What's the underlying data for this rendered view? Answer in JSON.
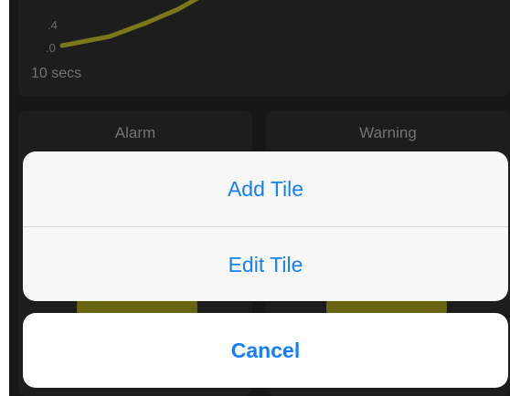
{
  "chart_tile": {
    "tick_labels": [
      ".4",
      ".0"
    ],
    "footer": "10 secs",
    "line_color": "#b5b028"
  },
  "tiles": [
    {
      "title": "Alarm"
    },
    {
      "title": "Warning"
    }
  ],
  "action_sheet": {
    "options": [
      {
        "label": "Add Tile"
      },
      {
        "label": "Edit Tile"
      }
    ],
    "cancel_label": "Cancel",
    "accent_color": "#157efb"
  }
}
